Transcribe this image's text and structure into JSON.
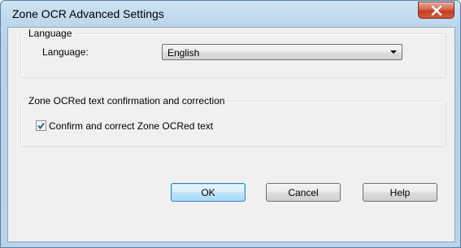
{
  "window": {
    "title": "Zone OCR Advanced Settings",
    "close_icon": "close-icon"
  },
  "language_group": {
    "legend": "Language",
    "label": "Language:",
    "selected": "English"
  },
  "confirm_group": {
    "legend": "Zone OCRed text confirmation and correction",
    "checkbox_label": "Confirm and correct Zone OCRed text",
    "checked": true
  },
  "buttons": {
    "ok": "OK",
    "cancel": "Cancel",
    "help": "Help"
  }
}
